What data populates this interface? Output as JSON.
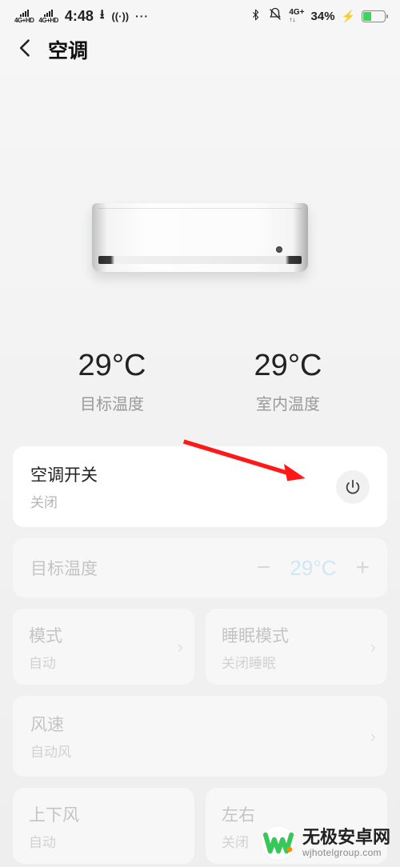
{
  "status": {
    "sig_label": "4G+HD",
    "time": "4:48",
    "net_label": "4G+",
    "battery_pct": "34%"
  },
  "header": {
    "title": "空调"
  },
  "temps": {
    "target": {
      "value": "29°C",
      "label": "目标温度"
    },
    "indoor": {
      "value": "29°C",
      "label": "室内温度"
    }
  },
  "switch": {
    "title": "空调开关",
    "status": "关闭"
  },
  "target_temp": {
    "title": "目标温度",
    "value": "29°C",
    "minus": "−",
    "plus": "+"
  },
  "mode": {
    "title": "模式",
    "value": "自动"
  },
  "sleep": {
    "title": "睡眠模式",
    "value": "关闭睡眠"
  },
  "fan": {
    "title": "风速",
    "value": "自动风"
  },
  "updown": {
    "title": "上下风",
    "value": "自动"
  },
  "leftright": {
    "title": "左右",
    "value": "关闭"
  },
  "watermark": {
    "cn": "无极安卓网",
    "en": "wjhotelgroup.com"
  }
}
